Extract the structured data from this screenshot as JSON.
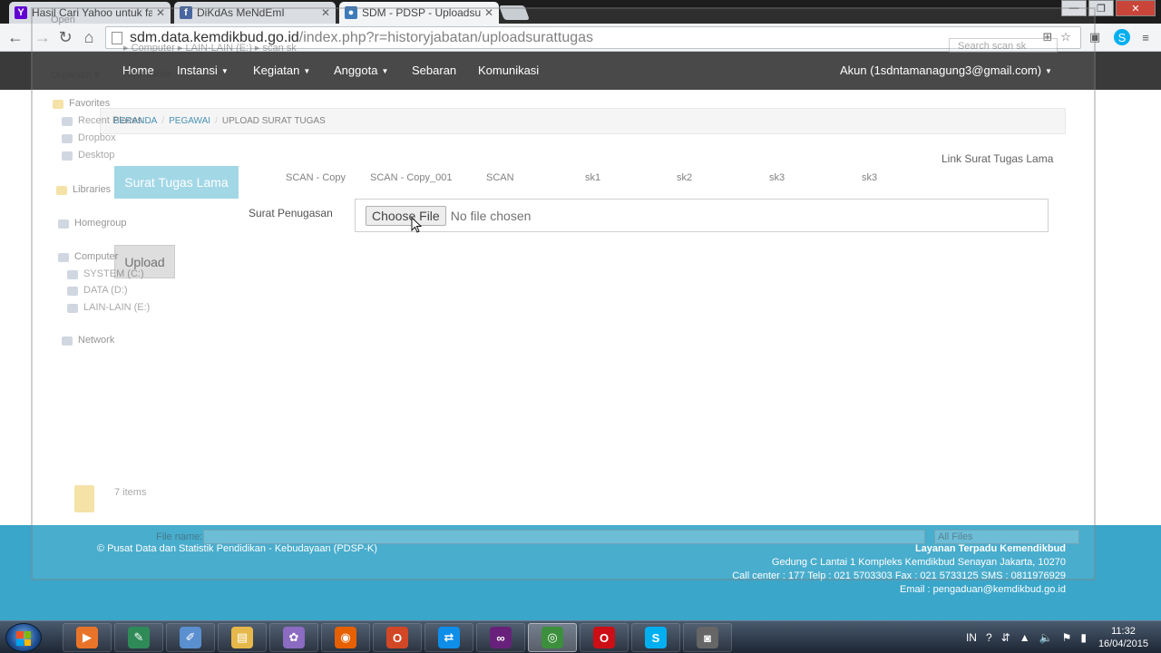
{
  "browser": {
    "tabs": [
      {
        "label": "Hasil Cari Yahoo untuk fa:",
        "favicon": "yahoo-icon",
        "color": "#6001d2",
        "glyph": "Y"
      },
      {
        "label": "DiKdAs MeNdEmI",
        "favicon": "facebook-icon",
        "color": "#3b5998",
        "glyph": "f"
      },
      {
        "label": "SDM - PDSP - Uploadsura",
        "favicon": "kemdikbud-icon",
        "color": "#2f6fb3",
        "glyph": "●"
      }
    ],
    "url_host": "sdm.data.kemdikbud.go.id",
    "url_path": "/index.php?r=historyjabatan/uploadsurattugas"
  },
  "nav": {
    "home": "Home",
    "instansi": "Instansi",
    "kegiatan": "Kegiatan",
    "anggota": "Anggota",
    "sebaran": "Sebaran",
    "komunikasi": "Komunikasi",
    "account": "Akun (1sdntamanagung3@gmail.com)"
  },
  "breadcrumb": {
    "beranda": "BERANDA",
    "pegawai": "PEGAWAI",
    "current": "UPLOAD SURAT TUGAS"
  },
  "content": {
    "link_old_label": "Link Surat Tugas Lama",
    "btn_old_label": "Surat Tugas Lama",
    "file_links": [
      "SCAN - Copy",
      "SCAN - Copy_001",
      "SCAN",
      "sk1",
      "sk2",
      "sk3",
      "sk3"
    ],
    "field_label": "Surat Penugasan",
    "choose_label": "Choose File",
    "no_file": "No file chosen",
    "upload_label": "Upload"
  },
  "footer": {
    "copyright": "© Pusat Data dan Statistik Pendidikan - Kebudayaan (PDSP-K)",
    "service_title": "Layanan Terpadu Kemendikbud",
    "address": "Gedung C Lantai 1 Kompleks Kemdikbud Senayan Jakarta, 10270",
    "callcenter": "Call center : 177 Telp : 021 5703303 Fax : 021 5733125 SMS : 0811976929",
    "email": "Email : pengaduan@kemdikbud.go.id"
  },
  "ghost_dialog": {
    "title": "Open",
    "path": "▸ Computer ▸ LAIN-LAIN (E:) ▸ scan sk",
    "search": "Search scan sk",
    "organize": "Organize ▾",
    "new_folder": "New folder",
    "favorites": "Favorites",
    "recent": "Recent Places",
    "dropbox": "Dropbox",
    "desktop": "Desktop",
    "libraries": "Libraries",
    "homegroup": "Homegroup",
    "computer": "Computer",
    "system": "SYSTEM (C:)",
    "data": "DATA (D:)",
    "lain": "LAIN-LAIN (E:)",
    "network": "Network",
    "items": "7 items",
    "file_name_label": "File name:",
    "file_type": "All Files"
  },
  "taskbar": {
    "apps": [
      {
        "name": "media-player-icon",
        "color": "#e8742a",
        "glyph": "▶"
      },
      {
        "name": "coreldraw-icon",
        "color": "#2e8b57",
        "glyph": "✎"
      },
      {
        "name": "notepad-icon",
        "color": "#5a8fd0",
        "glyph": "✐"
      },
      {
        "name": "folder-icon",
        "color": "#e6b84a",
        "glyph": "▤"
      },
      {
        "name": "paint-icon",
        "color": "#8c6bc2",
        "glyph": "✿"
      },
      {
        "name": "firefox-icon",
        "color": "#e66000",
        "glyph": "◉"
      },
      {
        "name": "office-icon",
        "color": "#d24726",
        "glyph": "O"
      },
      {
        "name": "teamviewer-icon",
        "color": "#0e8ee9",
        "glyph": "⇄"
      },
      {
        "name": "visualstudio-icon",
        "color": "#68217a",
        "glyph": "∞"
      },
      {
        "name": "chrome-icon",
        "color": "#3c8f3c",
        "glyph": "◎"
      },
      {
        "name": "opera-icon",
        "color": "#cc0f16",
        "glyph": "O"
      },
      {
        "name": "skype-icon",
        "color": "#00aff0",
        "glyph": "S"
      },
      {
        "name": "camera-icon",
        "color": "#666666",
        "glyph": "◙"
      }
    ],
    "lang": "IN",
    "time": "11:32",
    "date": "16/04/2015"
  }
}
